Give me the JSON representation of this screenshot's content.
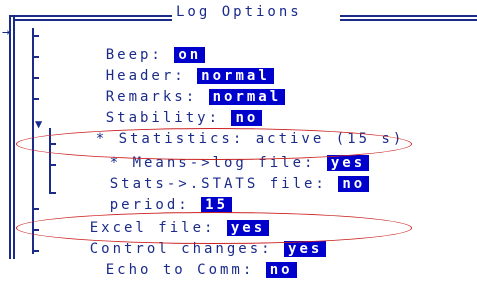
{
  "title": "Log Options",
  "items": [
    {
      "label": "Beep:",
      "value": "on"
    },
    {
      "label": "Header:",
      "value": "normal"
    },
    {
      "label": "Remarks:",
      "value": "normal"
    },
    {
      "label": "Stability:",
      "value": "no"
    },
    {
      "label": "* Statistics: active (15 s)"
    },
    {
      "label": "* Means->log file:",
      "value": "yes"
    },
    {
      "label": "Stats->.STATS file:",
      "value": "no"
    },
    {
      "label": "period:",
      "value": "15"
    },
    {
      "label": "Excel file:",
      "value": "yes"
    },
    {
      "label": "Control changes:",
      "value": "yes"
    },
    {
      "label": "Echo to Comm:",
      "value": "no"
    }
  ],
  "icons": {
    "cursor": "right-arrow-icon",
    "expand": "expanded-triangle-icon"
  },
  "colors": {
    "text": "#1a2b8a",
    "value_bg": "#0000cc",
    "annotation": "#cc2222"
  }
}
